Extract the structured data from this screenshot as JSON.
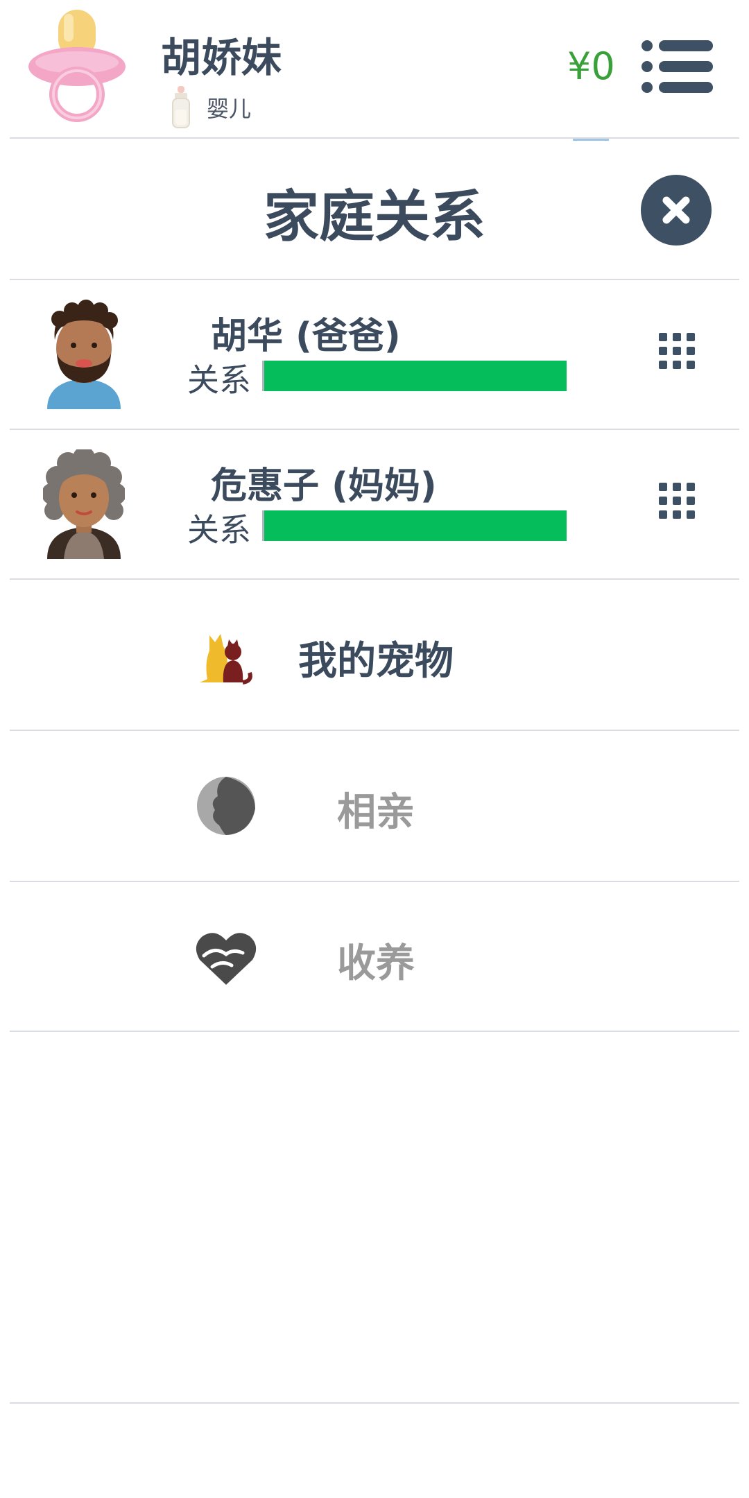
{
  "header": {
    "player_name": "胡娇妹",
    "stage_label": "婴儿",
    "money": "¥0"
  },
  "panel": {
    "title": "家庭关系"
  },
  "relations": [
    {
      "name": "胡华 (爸爸)",
      "relation_label": "关系",
      "relation_level": 1.0,
      "avatar": "father-avatar"
    },
    {
      "name": "危惠子 (妈妈)",
      "relation_label": "关系",
      "relation_level": 1.0,
      "avatar": "mother-avatar"
    }
  ],
  "actions": [
    {
      "label": "我的宠物",
      "icon": "pet-icon",
      "enabled": true
    },
    {
      "label": "相亲",
      "icon": "dating-icon",
      "enabled": false
    },
    {
      "label": "收养",
      "icon": "adopt-heart-icon",
      "enabled": false
    }
  ],
  "colors": {
    "text_primary": "#3b4a5c",
    "money_green": "#3aa03a",
    "relation_bar": "#06bd5b",
    "disabled_text": "#9a9a9a",
    "close_button_bg": "#3e5064"
  }
}
